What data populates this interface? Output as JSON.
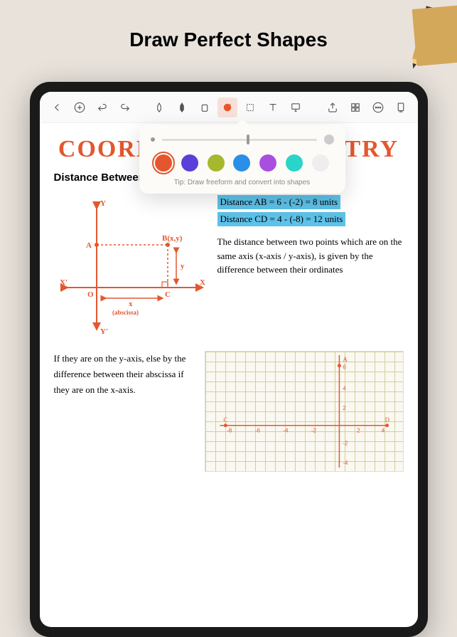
{
  "hero_title": "Draw Perfect Shapes",
  "toolbar": {
    "icons": [
      "back",
      "add",
      "undo",
      "redo",
      "pen1",
      "pen2",
      "eraser",
      "shape",
      "select",
      "text",
      "present",
      "share",
      "grid",
      "more",
      "page"
    ]
  },
  "popover": {
    "slider_value": 55,
    "colors": [
      {
        "hex": "#e4572e",
        "selected": true
      },
      {
        "hex": "#5b3fd9",
        "selected": false
      },
      {
        "hex": "#a6b82e",
        "selected": false
      },
      {
        "hex": "#2a8fe6",
        "selected": false
      },
      {
        "hex": "#a84fe0",
        "selected": false
      },
      {
        "hex": "#2ad4c9",
        "selected": false
      },
      {
        "hex": "#e8e8e8",
        "selected": false
      }
    ],
    "tip": "Tip: Draw freeform and convert into shapes"
  },
  "document": {
    "title": "COORDINATE GEOMETRY",
    "subtitle": "Distance Between Two Points on Coordinate Axes",
    "diagram": {
      "y_label": "Y",
      "y_prime": "Y'",
      "x_label": "X",
      "x_prime": "X'",
      "origin": "O",
      "point_a": "A",
      "point_b": "B(x,y)",
      "point_c": "C",
      "y_ord": "y",
      "x_ord": "x",
      "abscissa": "(abscissa)"
    },
    "highlight1": "Distance  AB = 6 - (-2) = 8 units",
    "highlight2": "Distance  CD = 4 - (-8) = 12 units",
    "para1": "The distance between two points which are on the same axis (x-axis / y-axis), is given by the difference between their  ordinates",
    "para2": "If they are on the y-axis, else by the difference between their abscissa if they are on the x-axis."
  },
  "chart_data": {
    "type": "line",
    "x": [
      -8,
      -6,
      -4,
      -2,
      0,
      2,
      4
    ],
    "y_axis_labels": [
      "6",
      "4",
      "2",
      "-2",
      "-4"
    ],
    "x_axis_labels": [
      "-8",
      "-6",
      "-4",
      "-2",
      "2",
      "4"
    ],
    "points": [
      {
        "name": "A",
        "x": 0,
        "y": 6
      },
      {
        "name": "C",
        "x": -8,
        "y": 0
      },
      {
        "name": "D",
        "x": 4,
        "y": 0
      }
    ],
    "title": "",
    "xlabel": "",
    "ylabel": "",
    "xlim": [
      -9,
      5
    ],
    "ylim": [
      -6,
      7
    ]
  }
}
